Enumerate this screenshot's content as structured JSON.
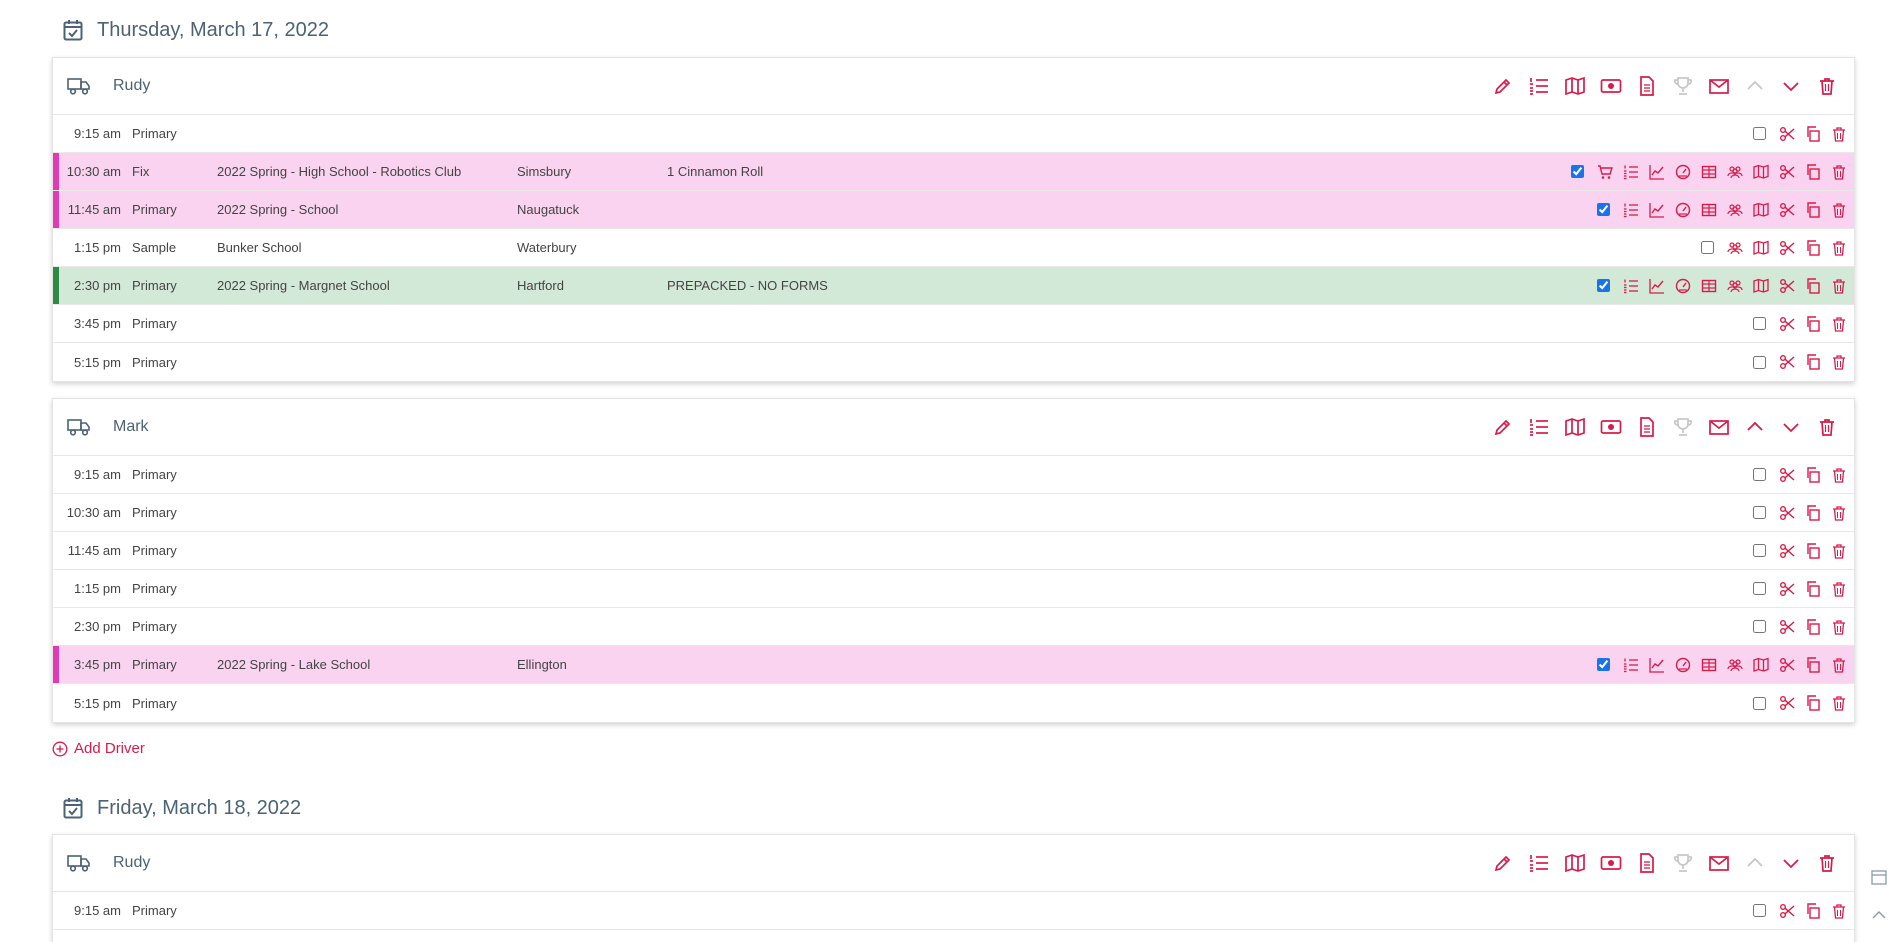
{
  "colors": {
    "accent": "#d81b4a",
    "muted": "#c7c7c7",
    "pink_bar": "#e23bb2",
    "green_bar": "#2d8a45"
  },
  "days": [
    {
      "title": "Thursday, March 17, 2022",
      "drivers": [
        {
          "name": "Rudy",
          "rows": [
            {
              "time": "9:15 am",
              "type": "Primary",
              "event": "",
              "city": "",
              "note": ""
            },
            {
              "time": "10:30 am",
              "type": "Fix",
              "event": "2022 Spring - High School - Robotics Club",
              "city": "Simsbury",
              "note": "1 Cinnamon Roll"
            },
            {
              "time": "11:45 am",
              "type": "Primary",
              "event": "2022 Spring - School",
              "city": "Naugatuck",
              "note": ""
            },
            {
              "time": "1:15 pm",
              "type": "Sample",
              "event": "Bunker School",
              "city": "Waterbury",
              "note": ""
            },
            {
              "time": "2:30 pm",
              "type": "Primary",
              "event": "2022 Spring - Margnet School",
              "city": "Hartford",
              "note": "PREPACKED - NO FORMS"
            },
            {
              "time": "3:45 pm",
              "type": "Primary",
              "event": "",
              "city": "",
              "note": ""
            },
            {
              "time": "5:15 pm",
              "type": "Primary",
              "event": "",
              "city": "",
              "note": ""
            }
          ]
        },
        {
          "name": "Mark",
          "rows": [
            {
              "time": "9:15 am",
              "type": "Primary",
              "event": "",
              "city": "",
              "note": ""
            },
            {
              "time": "10:30 am",
              "type": "Primary",
              "event": "",
              "city": "",
              "note": ""
            },
            {
              "time": "11:45 am",
              "type": "Primary",
              "event": "",
              "city": "",
              "note": ""
            },
            {
              "time": "1:15 pm",
              "type": "Primary",
              "event": "",
              "city": "",
              "note": ""
            },
            {
              "time": "2:30 pm",
              "type": "Primary",
              "event": "",
              "city": "",
              "note": ""
            },
            {
              "time": "3:45 pm",
              "type": "Primary",
              "event": "2022 Spring - Lake School",
              "city": "Ellington",
              "note": ""
            },
            {
              "time": "5:15 pm",
              "type": "Primary",
              "event": "",
              "city": "",
              "note": ""
            }
          ]
        }
      ],
      "add_driver_label": "Add Driver"
    },
    {
      "title": "Friday, March 18, 2022",
      "drivers": [
        {
          "name": "Rudy",
          "rows": [
            {
              "time": "9:15 am",
              "type": "Primary",
              "event": "",
              "city": "",
              "note": ""
            }
          ]
        }
      ]
    }
  ]
}
